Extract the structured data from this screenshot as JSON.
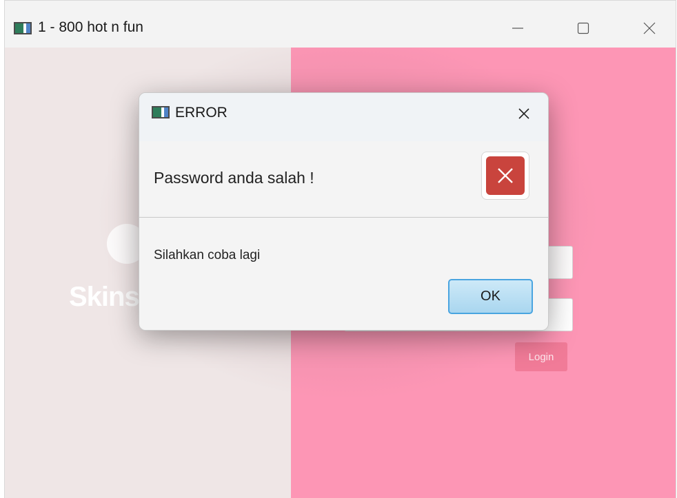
{
  "window": {
    "title": "1 - 800 hot n fun"
  },
  "login_screen": {
    "logo_text": "Skins",
    "login_button": "Login"
  },
  "dialog": {
    "title": "ERROR",
    "header_text": "Password anda salah !",
    "content_text": "Silahkan coba lagi",
    "ok_label": "OK"
  },
  "icons": {
    "app": "app-icon",
    "minimize": "minimize-icon",
    "maximize": "maximize-icon",
    "close": "close-icon",
    "error": "error-x-icon"
  },
  "colors": {
    "left_panel": "#efe6e6",
    "right_panel": "#fd96b5",
    "login_button": "#f17b98",
    "error_icon": "#c9443d",
    "ok_border": "#49a4e0"
  }
}
